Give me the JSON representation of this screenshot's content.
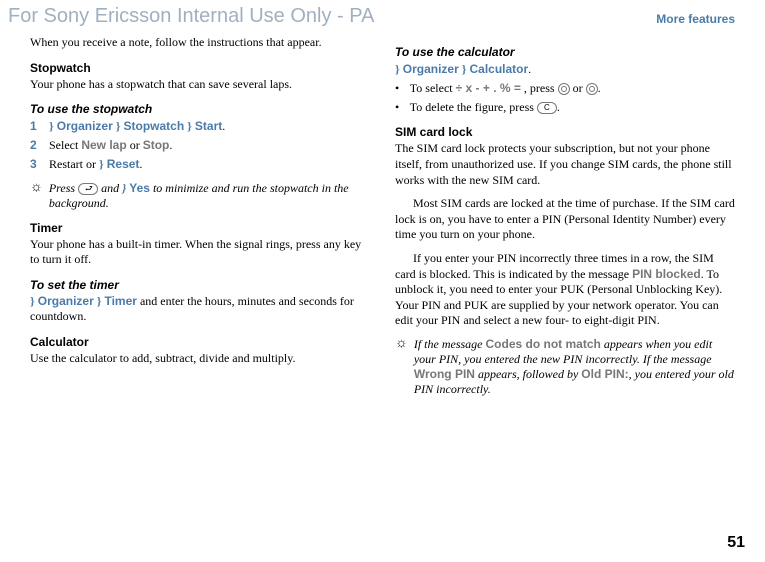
{
  "watermark": "For Sony Ericsson Internal Use Only - PA",
  "header_link": "More features",
  "page_number": "51",
  "col1": {
    "intro": "When you receive a note, follow the instructions that appear.",
    "stopwatch_heading": "Stopwatch",
    "stopwatch_text": "Your phone has a stopwatch that can save several laps.",
    "use_stopwatch_heading": "To use the stopwatch",
    "step1_num": "1",
    "step1_org": "Organizer",
    "step1_sw": "Stopwatch",
    "step1_start": "Start",
    "step2_num": "2",
    "step2_select": "Select ",
    "step2_newlap": "New lap",
    "step2_or": " or ",
    "step2_stop": "Stop",
    "step3_num": "3",
    "step3_restart": "Restart or ",
    "step3_reset": "Reset",
    "tip_press": "Press ",
    "tip_and": " and ",
    "tip_yes": "Yes",
    "tip_rest": " to minimize and run the stopwatch in the background.",
    "timer_heading": "Timer",
    "timer_text": "Your phone has a built-in timer. When the signal rings, press any key to turn it off.",
    "set_timer_heading": "To set the timer",
    "set_timer_org": "Organizer",
    "set_timer_timer": "Timer",
    "set_timer_rest": " and enter the hours, minutes and seconds for countdown.",
    "calc_heading": "Calculator",
    "calc_text": "Use the calculator to add, subtract, divide and multiply."
  },
  "col2": {
    "use_calc_heading": "To use the calculator",
    "uc_org": "Organizer",
    "uc_calc": "Calculator",
    "uc_select_pre": "To select ",
    "uc_select_ops": "÷ x - + . % =",
    "uc_select_mid": ", press ",
    "uc_select_or": " or ",
    "uc_delete_pre": "To delete the figure, press ",
    "sim_heading": "SIM card lock",
    "sim_p1": "The SIM card lock protects your subscription, but not your phone itself, from unauthorized use. If you change SIM cards, the phone still works with the new SIM card.",
    "sim_p2": "Most SIM cards are locked at the time of purchase. If the SIM card lock is on, you have to enter a PIN (Personal Identity Number) every time you turn on your phone.",
    "sim_p3a": "If you enter your PIN incorrectly three times in a row, the SIM card is blocked. This is indicated by the message ",
    "sim_pin_blocked": "PIN blocked",
    "sim_p3b": ". To unblock it, you need to enter your PUK (Personal Unblocking Key). Your PIN and PUK are supplied by your network operator. You can edit your PIN and select a new four- to eight-digit PIN.",
    "tip2_a": "If the message ",
    "tip2_codes": "Codes do not match",
    "tip2_b": " appears when you edit your PIN, you entered the new PIN incorrectly. If the message ",
    "tip2_wrong": "Wrong PIN",
    "tip2_c": " appears, followed by ",
    "tip2_old": "Old PIN:",
    "tip2_d": ", you entered your old PIN incorrectly."
  }
}
